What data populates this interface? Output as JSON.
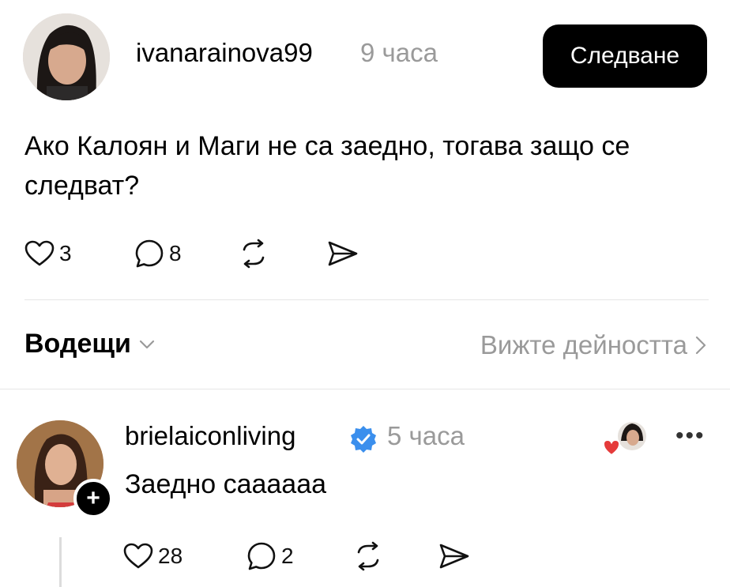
{
  "post": {
    "username": "ivanarainova99",
    "time": "9 часа",
    "follow_label": "Следване",
    "text": "Ако Калоян и Маги не са заедно, тогава защо се следват?",
    "likes": "3",
    "comments": "8"
  },
  "replies_header": {
    "sort_label": "Водещи",
    "activity_label": "Вижте дейността"
  },
  "reply": {
    "username": "brielaiconliving",
    "time": "5 часа",
    "text": "Заедно саааааа",
    "likes": "28",
    "comments": "2",
    "more_label": "•••"
  },
  "icons": {
    "like": "heart-icon",
    "comment": "speech-bubble-icon",
    "repost": "repost-icon",
    "share": "send-icon",
    "verified": "verified-badge-icon"
  },
  "colors": {
    "follow_bg": "#000000",
    "muted_text": "#9a9a9a",
    "verified_blue": "#3b8fed",
    "heart_red": "#e53b3b"
  }
}
